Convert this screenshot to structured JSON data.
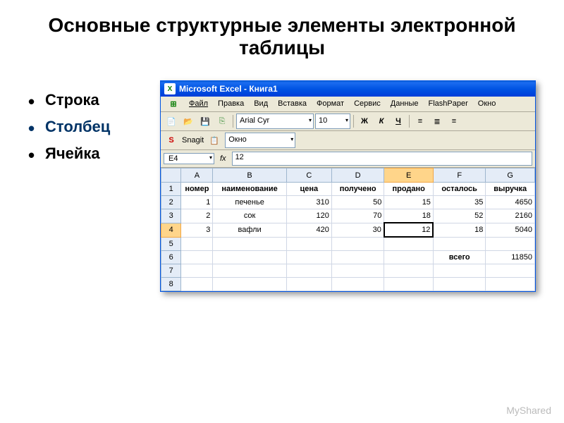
{
  "slide": {
    "title": "Основные структурные элементы электронной таблицы",
    "bullets": [
      "Строка",
      "Столбец",
      "Ячейка"
    ],
    "highlight_index": 1
  },
  "window": {
    "title": "Microsoft Excel - Книга1",
    "app_icon": "X"
  },
  "menu": {
    "items": [
      "Файл",
      "Правка",
      "Вид",
      "Вставка",
      "Формат",
      "Сервис",
      "Данные",
      "FlashPaper",
      "Окно"
    ]
  },
  "toolbar": {
    "font_name": "Arial Cyr",
    "font_size": "10",
    "bold": "Ж",
    "italic": "К",
    "underline": "Ч"
  },
  "snagit": {
    "label": "Snagit",
    "window_label": "Окно"
  },
  "formula": {
    "cell_ref": "E4",
    "fx_label": "fx",
    "value": "12"
  },
  "columns": [
    "A",
    "B",
    "C",
    "D",
    "E",
    "F",
    "G"
  ],
  "row_numbers": [
    "1",
    "2",
    "3",
    "4",
    "5",
    "6",
    "7",
    "8"
  ],
  "headers": [
    "номер",
    "наименование",
    "цена",
    "получено",
    "продано",
    "осталось",
    "выручка"
  ],
  "rows": [
    [
      "1",
      "печенье",
      "310",
      "50",
      "15",
      "35",
      "4650"
    ],
    [
      "2",
      "сок",
      "120",
      "70",
      "18",
      "52",
      "2160"
    ],
    [
      "3",
      "вафли",
      "420",
      "30",
      "12",
      "18",
      "5040"
    ]
  ],
  "total": {
    "label": "всего",
    "value": "11850"
  },
  "active_cell": {
    "row": 4,
    "col": "E"
  },
  "watermark": "MyShared"
}
